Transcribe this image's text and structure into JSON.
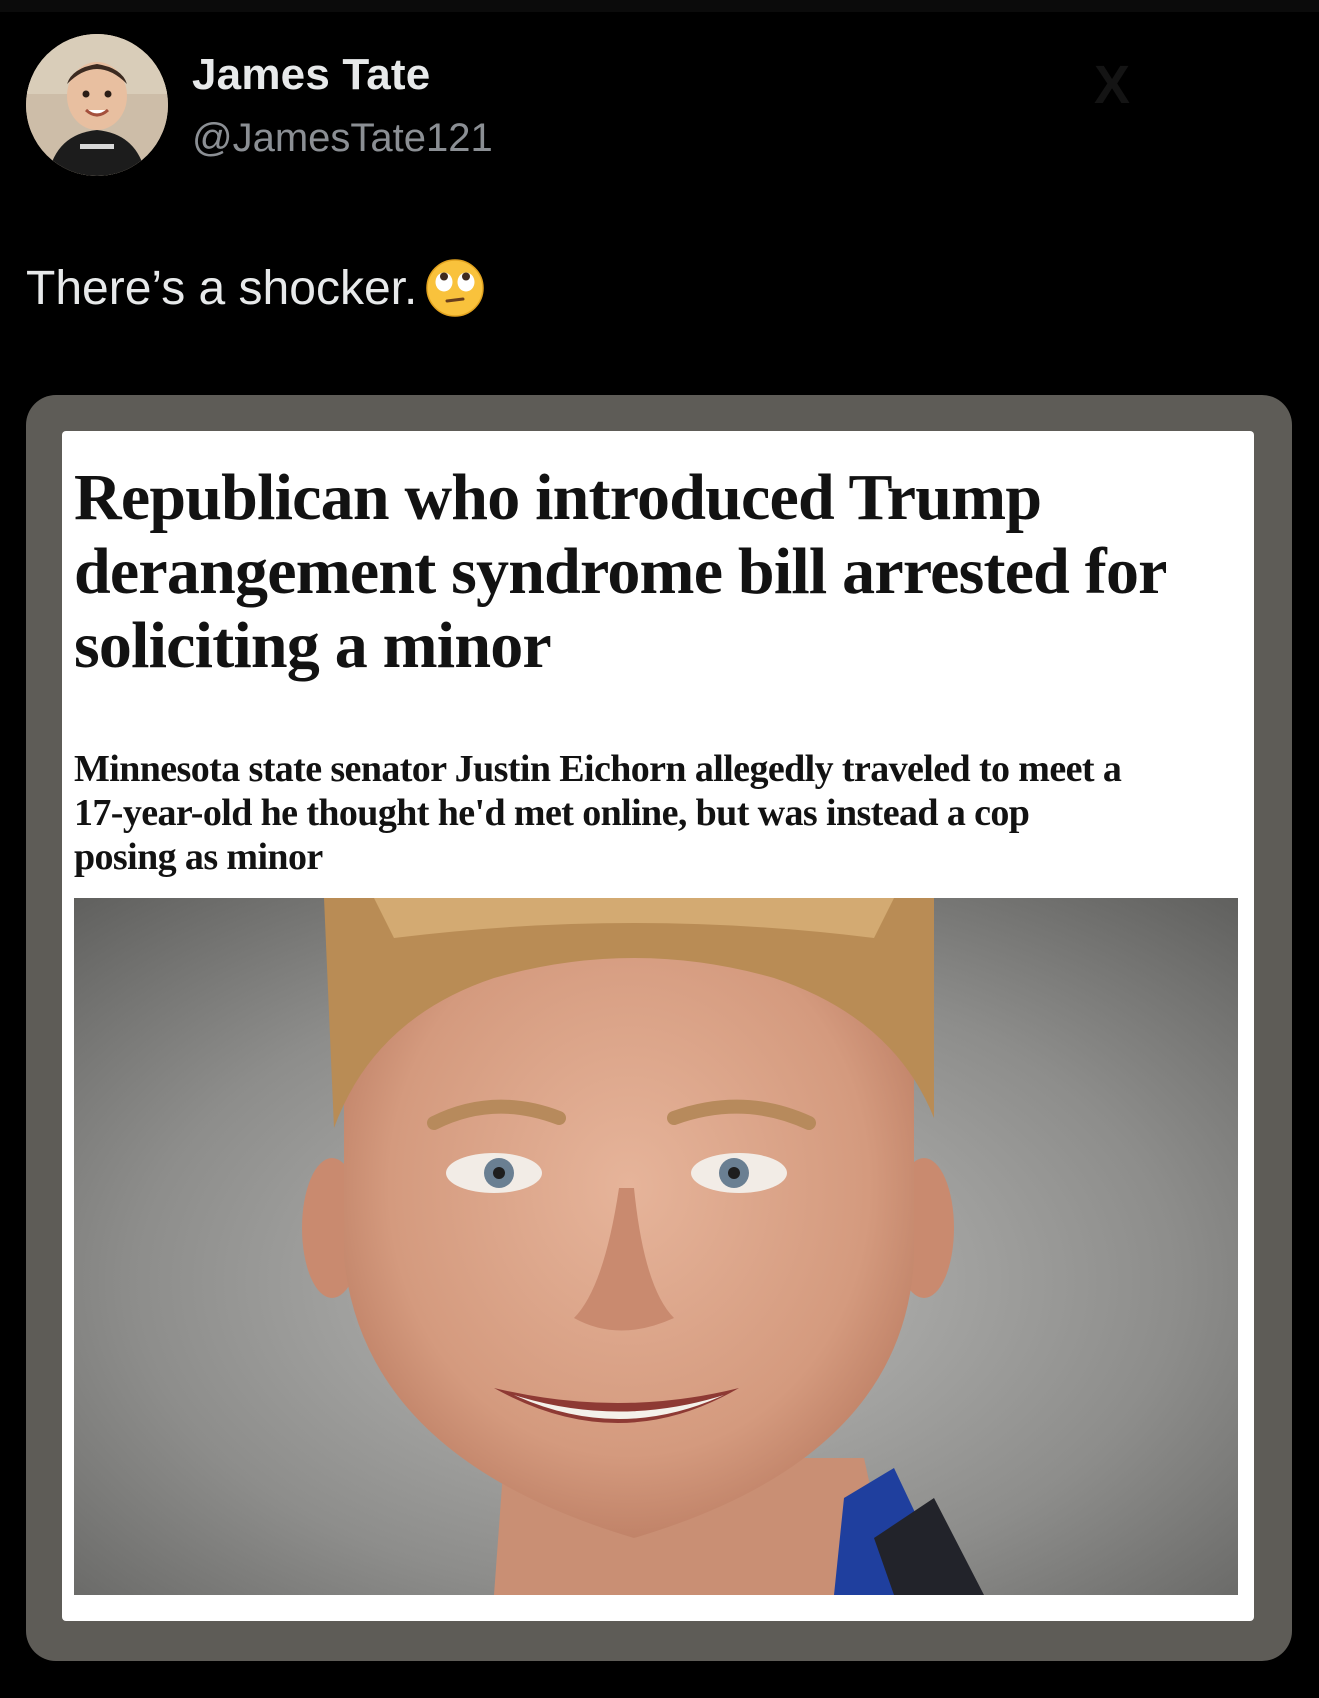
{
  "tweet": {
    "author": {
      "display_name": "James Tate",
      "handle": "@JamesTate121"
    },
    "text": "There’s a shocker.",
    "emoji": "face-with-rolling-eyes-icon"
  },
  "article": {
    "headline": "Republican who introduced Trump derangement syndrome bill arrested for soliciting a minor",
    "standfirst": "Minnesota state senator Justin Eichorn allegedly traveled to meet a 17-year-old he thought he'd met online, but was instead a cop posing as minor"
  },
  "colors": {
    "background": "#000000",
    "name_text": "#e7e9ea",
    "handle_text": "#8b8f94",
    "media_frame": "#5e5c57",
    "article_bg": "#ffffff",
    "headline_text": "#121212"
  }
}
